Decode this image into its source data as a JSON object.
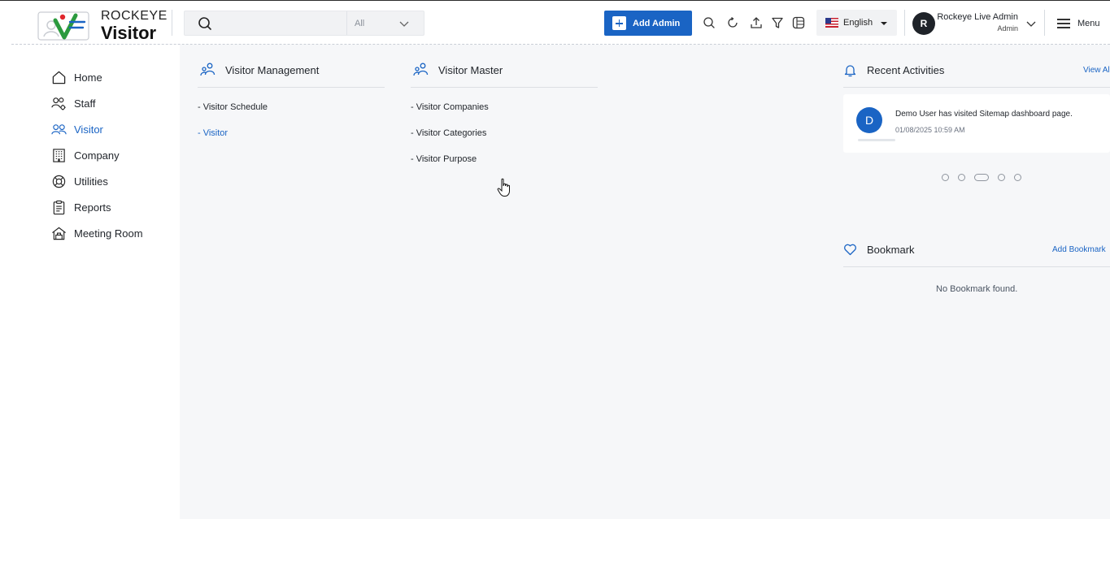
{
  "header": {
    "logo": {
      "line1": "ROCKEYE",
      "line2": "Visitor"
    },
    "search": {
      "placeholder": "",
      "value": "",
      "scope": "All"
    },
    "add_admin_label": "Add Admin",
    "toolbar_icons": [
      "search-icon",
      "refresh-icon",
      "upload-icon",
      "filter-icon",
      "layout-icon"
    ],
    "language": {
      "label": "English",
      "flag": "us-flag-icon"
    },
    "user": {
      "initial": "R",
      "name": "Rockeye Live Admin",
      "role": "Admin"
    },
    "menu_label": "Menu"
  },
  "sidebar": {
    "items": [
      {
        "label": "Home",
        "icon": "home-icon",
        "active": false
      },
      {
        "label": "Staff",
        "icon": "staff-icon",
        "active": false
      },
      {
        "label": "Visitor",
        "icon": "visitor-icon",
        "active": true
      },
      {
        "label": "Company",
        "icon": "company-icon",
        "active": false
      },
      {
        "label": "Utilities",
        "icon": "utilities-icon",
        "active": false
      },
      {
        "label": "Reports",
        "icon": "reports-icon",
        "active": false
      },
      {
        "label": "Meeting Room",
        "icon": "meeting-room-icon",
        "active": false
      }
    ]
  },
  "main": {
    "visitor_management": {
      "title": "Visitor Management",
      "links": [
        "- Visitor Schedule",
        "- Visitor"
      ],
      "active_link": "- Visitor"
    },
    "visitor_master": {
      "title": "Visitor Master",
      "links": [
        "- Visitor Companies",
        "- Visitor Categories",
        "- Visitor Purpose"
      ]
    }
  },
  "recent_activities": {
    "title": "Recent Activities",
    "view_all_label": "View All",
    "items": [
      {
        "initial": "D",
        "text": "Demo User has visited Sitemap dashboard page.",
        "time": "01/08/2025 10:59 AM"
      }
    ],
    "carousel": {
      "count": 5,
      "active_index": 2
    }
  },
  "bookmark": {
    "title": "Bookmark",
    "add_label": "Add Bookmark",
    "empty_message": "No Bookmark found."
  },
  "colors": {
    "accent": "#1a64c4",
    "main_bg": "#f6f7f9",
    "text": "#1f2329"
  }
}
